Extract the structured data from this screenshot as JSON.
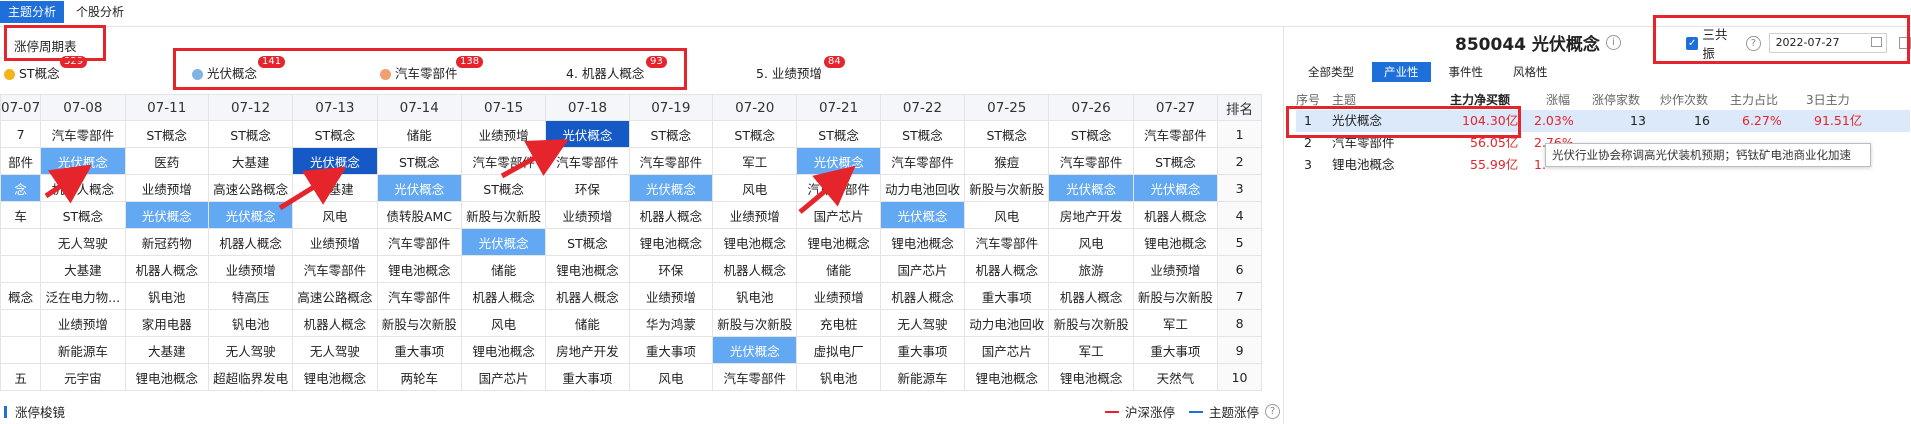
{
  "top_tabs": [
    "主题分析",
    "个股分析"
  ],
  "left_panel": {
    "title": "涨停周期表",
    "themes": [
      {
        "label": "ST概念",
        "count": "329",
        "dot": "#f2b41a"
      },
      {
        "label": "光伏概念",
        "count": "141",
        "dot": "#7fb3e6"
      },
      {
        "label": "汽车零部件",
        "count": "138",
        "dot": "#f0a070"
      },
      {
        "label": "4. 机器人概念",
        "count": "93",
        "dot": ""
      },
      {
        "label": "5. 业绩预增",
        "count": "84",
        "dot": ""
      }
    ],
    "grid_headers": [
      "07-07",
      "07-08",
      "07-11",
      "07-12",
      "07-13",
      "07-14",
      "07-15",
      "07-18",
      "07-19",
      "07-20",
      "07-21",
      "07-22",
      "07-25",
      "07-26",
      "07-27",
      "排名"
    ],
    "grid_rows": [
      [
        "7",
        "汽车零部件",
        "ST概念",
        "ST概念",
        "ST概念",
        "储能",
        "业绩预增",
        "光伏概念",
        "ST概念",
        "ST概念",
        "ST概念",
        "ST概念",
        "ST概念",
        "ST概念",
        "汽车零部件",
        "1"
      ],
      [
        "部件",
        "光伏概念",
        "医药",
        "大基建",
        "光伏概念",
        "ST概念",
        "汽车零部件",
        "汽车零部件",
        "汽车零部件",
        "军工",
        "光伏概念",
        "汽车零部件",
        "猴痘",
        "汽车零部件",
        "ST概念",
        "2"
      ],
      [
        "念",
        "机器人概念",
        "业绩预增",
        "高速公路概念",
        "大基建",
        "光伏概念",
        "ST概念",
        "环保",
        "光伏概念",
        "风电",
        "汽车零部件",
        "动力电池回收",
        "新股与次新股",
        "光伏概念",
        "光伏概念",
        "3"
      ],
      [
        "车",
        "ST概念",
        "光伏概念",
        "光伏概念",
        "风电",
        "债转股AMC",
        "新股与次新股",
        "业绩预增",
        "机器人概念",
        "业绩预增",
        "国产芯片",
        "光伏概念",
        "风电",
        "房地产开发",
        "机器人概念",
        "4"
      ],
      [
        "",
        "无人驾驶",
        "新冠药物",
        "机器人概念",
        "业绩预增",
        "汽车零部件",
        "光伏概念",
        "ST概念",
        "锂电池概念",
        "锂电池概念",
        "锂电池概念",
        "锂电池概念",
        "汽车零部件",
        "风电",
        "锂电池概念",
        "5"
      ],
      [
        "",
        "大基建",
        "机器人概念",
        "业绩预增",
        "汽车零部件",
        "锂电池概念",
        "储能",
        "锂电池概念",
        "环保",
        "机器人概念",
        "储能",
        "国产芯片",
        "机器人概念",
        "旅游",
        "业绩预增",
        "6"
      ],
      [
        "概念",
        "泛在电力物...",
        "钒电池",
        "特高压",
        "高速公路概念",
        "汽车零部件",
        "机器人概念",
        "机器人概念",
        "业绩预增",
        "钒电池",
        "业绩预增",
        "机器人概念",
        "重大事项",
        "机器人概念",
        "新股与次新股",
        "7"
      ],
      [
        "",
        "业绩预增",
        "家用电器",
        "钒电池",
        "机器人概念",
        "新股与次新股",
        "风电",
        "储能",
        "华为鸿蒙",
        "新股与次新股",
        "充电桩",
        "无人驾驶",
        "动力电池回收",
        "新股与次新股",
        "军工",
        "8"
      ],
      [
        "",
        "新能源车",
        "大基建",
        "无人驾驶",
        "无人驾驶",
        "重大事项",
        "锂电池概念",
        "房地产开发",
        "重大事项",
        "光伏概念",
        "虚拟电厂",
        "重大事项",
        "国产芯片",
        "军工",
        "重大事项",
        "9"
      ],
      [
        "五",
        "元宇宙",
        "锂电池概念",
        "超超临界发电",
        "锂电池概念",
        "两轮车",
        "国产芯片",
        "重大事项",
        "风电",
        "汽车零部件",
        "钒电池",
        "新能源车",
        "锂电池概念",
        "锂电池概念",
        "天然气",
        "10"
      ]
    ],
    "bottom_title": "涨停梭镜",
    "legend": [
      {
        "label": "沪深涨停",
        "color": "#e5242b"
      },
      {
        "label": "主题涨停",
        "color": "#1e6fd9"
      }
    ]
  },
  "right_panel": {
    "title": "850044 光伏概念",
    "checkbox_label": "三共振",
    "checkbox_checked": true,
    "date": "2022-07-27",
    "tabs": [
      "全部类型",
      "产业性",
      "事件性",
      "风格性"
    ],
    "active_tab": "产业性",
    "table_headers": [
      "序号",
      "主题",
      "主力净买额",
      "涨幅",
      "涨停家数",
      "炒作次数",
      "主力占比",
      "3日主力"
    ],
    "rows": [
      {
        "no": "1",
        "theme": "光伏概念",
        "net_buy": "104.30亿",
        "change": "2.03%",
        "limit_up": "13",
        "hype": "16",
        "ratio": "6.27%",
        "main3d": "91.51亿"
      },
      {
        "no": "2",
        "theme": "汽车零部件",
        "net_buy": "56.05亿",
        "change": "2.76%",
        "limit_up": "",
        "hype": "",
        "ratio": "",
        "main3d": ""
      },
      {
        "no": "3",
        "theme": "锂电池概念",
        "net_buy": "55.99亿",
        "change": "1.",
        "limit_up": "",
        "hype": "",
        "ratio": "",
        "main3d": ""
      }
    ],
    "tooltip": "光伏行业协会称调高光伏装机预期；钙钛矿电池商业化加速"
  },
  "colors": {
    "accent": "#1e6fd9",
    "highlight": "#62a8f3",
    "highlight_strong": "#1559c6",
    "annotation": "#e5242b"
  }
}
